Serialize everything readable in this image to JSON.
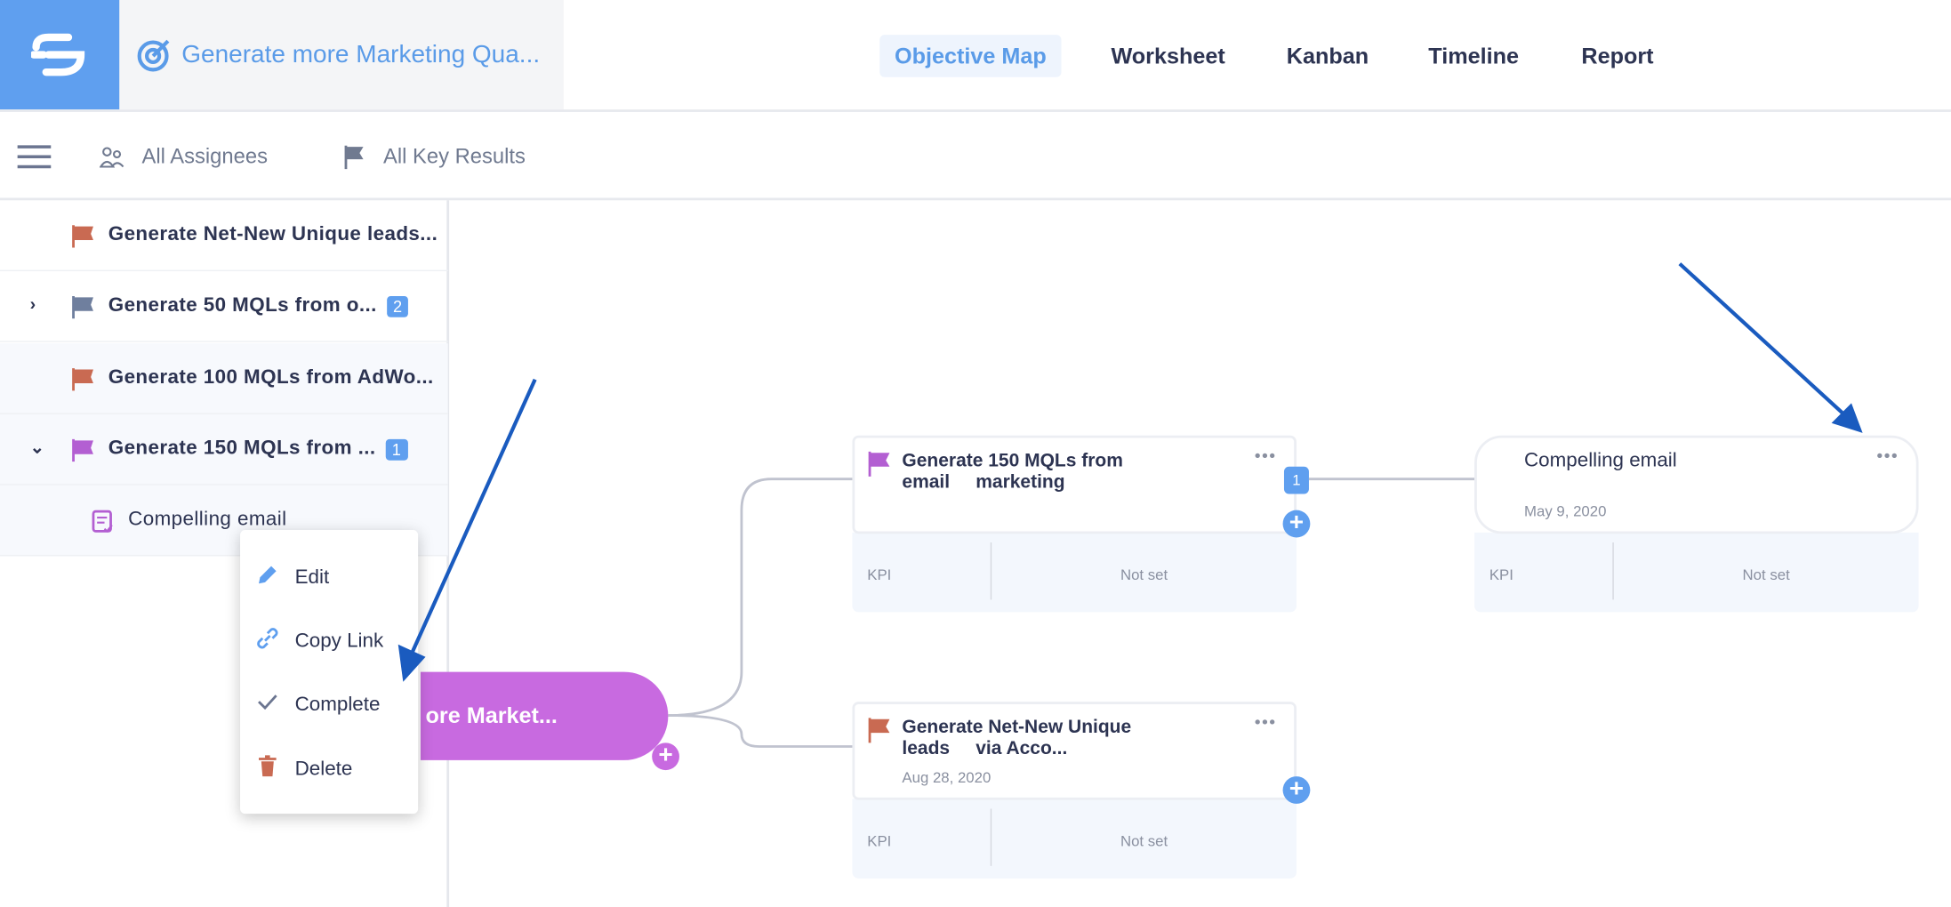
{
  "colors": {
    "brand": "#5f9fef",
    "objective": "#c86ae0",
    "arrow": "#1a5bbf"
  },
  "header": {
    "title": "Generate more Marketing Qua...",
    "tabs": [
      {
        "label": "Objective Map",
        "active": true
      },
      {
        "label": "Worksheet"
      },
      {
        "label": "Kanban"
      },
      {
        "label": "Timeline"
      },
      {
        "label": "Report"
      }
    ]
  },
  "toolbar": {
    "assignees": "All Assignees",
    "key_results": "All Key Results"
  },
  "sidebar": {
    "items": [
      {
        "label": "Generate Net-New Unique leads...",
        "flag": "#c96a52"
      },
      {
        "label": "Generate 50 MQLs from o...",
        "flag": "#6f7f9e",
        "count": "2",
        "chevron": "right"
      },
      {
        "label": "Generate 100 MQLs from AdWo...",
        "flag": "#c96a52"
      },
      {
        "label": "Generate 150 MQLs from ...",
        "flag": "#b35fd2",
        "count": "1",
        "chevron": "down"
      },
      {
        "label": "Compelling email",
        "icon": "task-icon"
      }
    ]
  },
  "context_menu": {
    "items": [
      {
        "label": "Edit",
        "icon": "pencil-icon"
      },
      {
        "label": "Copy Link",
        "icon": "link-icon"
      },
      {
        "label": "Complete",
        "icon": "check-icon"
      },
      {
        "label": "Delete",
        "icon": "trash-icon"
      }
    ]
  },
  "map": {
    "root": {
      "label": "ore Market..."
    },
    "cards": [
      {
        "title": "Generate 150 MQLs from\nemail     marketing",
        "count": "1",
        "kpi_label": "KPI",
        "kpi_value": "Not set"
      },
      {
        "title": "Compelling email",
        "date": "May 9, 2020",
        "kpi_label": "KPI",
        "kpi_value": "Not set"
      },
      {
        "title": "Generate Net-New Unique\nleads     via Acco...",
        "date": "Aug 28, 2020",
        "kpi_label": "KPI",
        "kpi_value": "Not set"
      }
    ]
  }
}
